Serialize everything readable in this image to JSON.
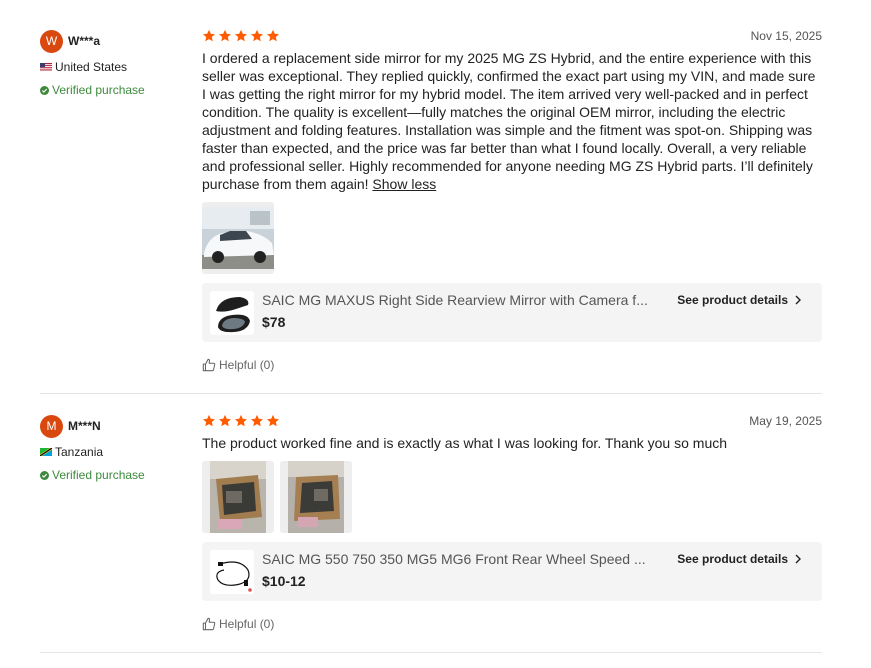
{
  "colors": {
    "avatar": "#d9480f",
    "star": "#fd5d00",
    "verified": "#3d8a3d",
    "product_bg": "#f4f4f4"
  },
  "reviews": [
    {
      "avatar_letter": "W",
      "user_name": "W***a",
      "country": "United States",
      "country_flag": "us-flag-icon",
      "verified": "Verified purchase",
      "rating": 5,
      "date": "Nov 15, 2025",
      "text": "I ordered a replacement side mirror for my 2025 MG ZS Hybrid, and the entire experience with this seller was exceptional. They replied quickly, confirmed the exact part using my VIN, and made sure I was getting the right mirror for my hybrid model. The item arrived very well-packed and in perfect condition. The quality is excellent—fully matches the original OEM mirror, including the electric adjustment and folding features. Installation was simple and the fitment was spot-on. Shipping was faster than expected, and the price was far better than what I found locally. Overall, a very reliable and professional seller. Highly recommended for anyone needing MG ZS Hybrid parts. I’ll definitely purchase from them again!",
      "show_less": "Show less",
      "product": {
        "title": "SAIC MG MAXUS Right Side Rearview Mirror with Camera f...",
        "price": "$78",
        "details_label": "See product details"
      },
      "helpful": "Helpful (0)"
    },
    {
      "avatar_letter": "M",
      "user_name": "M***N",
      "country": "Tanzania",
      "country_flag": "tz-flag-icon",
      "verified": "Verified purchase",
      "rating": 5,
      "date": "May 19, 2025",
      "text": "The product worked fine and is exactly as what I was looking for. Thank you so much",
      "product": {
        "title": "SAIC MG 550 750 350 MG5 MG6 Front Rear Wheel Speed ...",
        "price": "$10-12",
        "details_label": "See product details"
      },
      "helpful": "Helpful (0)"
    }
  ]
}
